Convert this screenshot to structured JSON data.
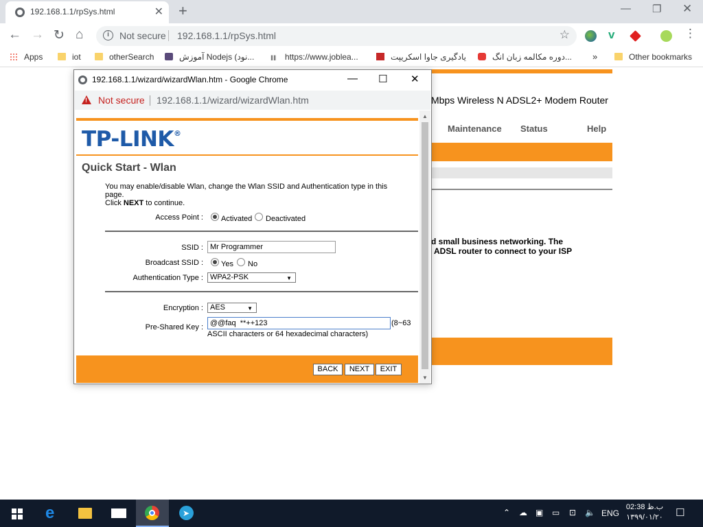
{
  "browser": {
    "tab_title": "192.168.1.1/rpSys.html",
    "omnibox_security": "Not secure",
    "omnibox_url": "192.168.1.1/rpSys.html",
    "bookmarks": [
      "Apps",
      "iot",
      "otherSearch",
      "آموزش Nodejs (نود...",
      "https://www.joblea...",
      "یادگیری جاوا اسکریپت",
      "دوره مکالمه زبان انگ...",
      "»",
      "Other bookmarks"
    ]
  },
  "background_page": {
    "title": "Mbps Wireless N ADSL2+ Modem Router",
    "menu": [
      "Maintenance",
      "Status",
      "Help"
    ],
    "text_line1": "d small business networking. The",
    "text_line2": "ADSL router to connect to your ISP"
  },
  "popup": {
    "window_title": "192.168.1.1/wizard/wizardWlan.htm - Google Chrome",
    "security": "Not secure",
    "url": "192.168.1.1/wizard/wizardWlan.htm",
    "logo": "TP-LINK",
    "logo_mark": "®",
    "page_title": "Quick Start - Wlan",
    "description_line1": "You may enable/disable Wlan, change the Wlan SSID and Authentication type in this page.",
    "description_line2_prefix": "Click ",
    "description_line2_bold": "NEXT",
    "description_line2_suffix": " to continue.",
    "access_point_label": "Access Point :",
    "access_point_options": [
      "Activated",
      "Deactivated"
    ],
    "access_point_selected": "Activated",
    "ssid_label": "SSID :",
    "ssid_value": "Mr Programmer",
    "broadcast_label": "Broadcast SSID :",
    "broadcast_options": [
      "Yes",
      "No"
    ],
    "broadcast_selected": "Yes",
    "auth_label": "Authentication Type :",
    "auth_value": "WPA2-PSK",
    "encryption_label": "Encryption :",
    "encryption_value": "AES",
    "psk_label": "Pre-Shared Key :",
    "psk_value": "@@faq  **++123",
    "psk_hint_short": "(8~63",
    "psk_hint_long": "ASCII characters or 64 hexadecimal characters)",
    "buttons": [
      "BACK",
      "NEXT",
      "EXIT"
    ]
  },
  "taskbar": {
    "language": "ENG",
    "time": "02:38 ب.ظ",
    "date": "۱۳۹۹/۰۱/۲۰"
  },
  "colors": {
    "accent_orange": "#f7931e",
    "tplink_blue": "#1e5aa8",
    "taskbar": "#101a2a"
  }
}
